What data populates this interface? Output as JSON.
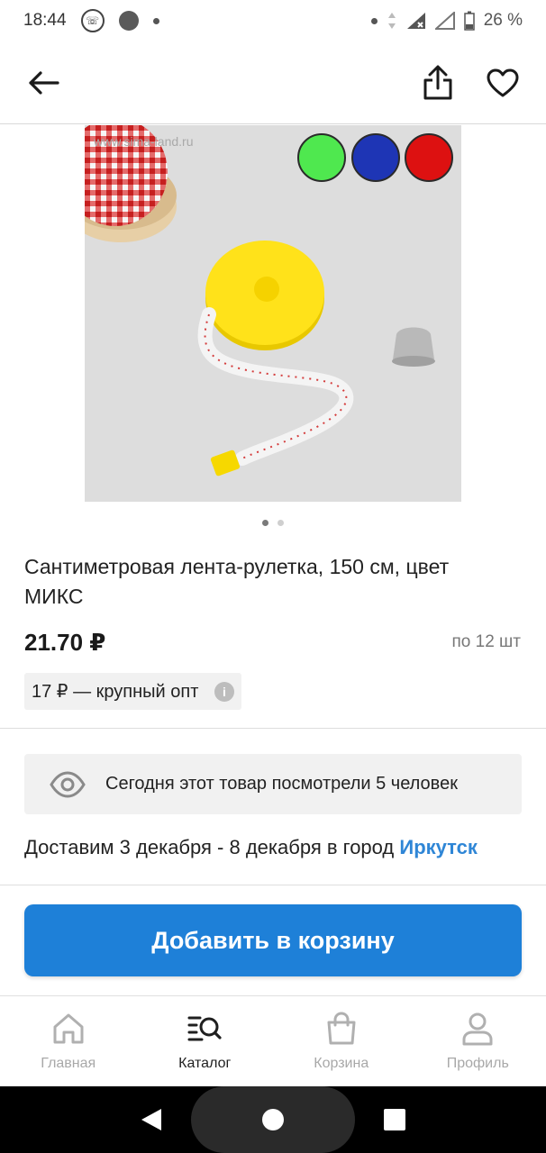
{
  "status_bar": {
    "time": "18:44",
    "battery": "26 %"
  },
  "product": {
    "watermark": "www.sima-land.ru",
    "swatch_colors": [
      "#4fe84f",
      "#1e35b5",
      "#dd1111"
    ],
    "title": "Сантиметровая лента-рулетка, 150 см, цвет МИКС",
    "price": "21.70 ₽",
    "per_unit": "по 12 шт",
    "wholesale": "17 ₽ — крупный опт",
    "info_glyph": "i",
    "views": "Сегодня этот товар посмотрели 5 человек",
    "delivery_text": "Доставим 3 декабря - 8 декабря в город ",
    "delivery_city": "Иркутск"
  },
  "cart_button": "Добавить в корзину",
  "bottom_nav": [
    {
      "label": "Главная",
      "icon": "home-icon"
    },
    {
      "label": "Каталог",
      "icon": "catalog-search-icon",
      "active": true
    },
    {
      "label": "Корзина",
      "icon": "cart-bag-icon"
    },
    {
      "label": "Профиль",
      "icon": "profile-icon"
    }
  ],
  "colors": {
    "accent": "#1e80d8",
    "link": "#2f86d6"
  }
}
